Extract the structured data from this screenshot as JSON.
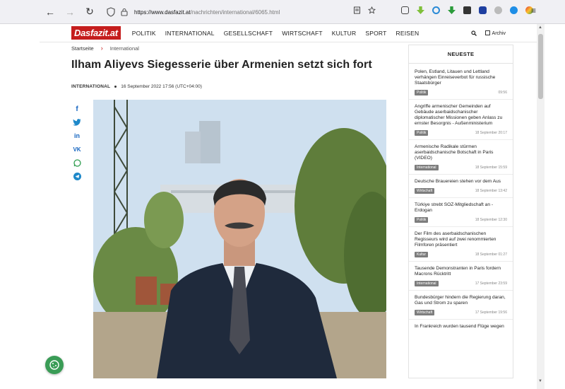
{
  "browser": {
    "url_host": "https://www.dasfazit.at",
    "url_path": "/nachrichten/international/6065.html",
    "icons": [
      "back-arrow-icon",
      "forward-arrow-icon",
      "reload-icon",
      "shield-icon",
      "lock-icon",
      "reader-view-icon",
      "bookmark-star-icon",
      "menu-icon"
    ]
  },
  "site": {
    "logo": "Dasfazit.at",
    "nav": [
      "POLITIK",
      "INTERNATIONAL",
      "GESELLSCHAFT",
      "WIRTSCHAFT",
      "KULTUR",
      "SPORT",
      "REISEN"
    ],
    "archive_label": "Archiv",
    "brand_color": "#c51d1d"
  },
  "breadcrumb": {
    "home": "Startseite",
    "separator": "›",
    "current": "International"
  },
  "article": {
    "title": "Ilham Aliyevs Siegesserie über Armenien setzt sich fort",
    "category": "INTERNATIONAL",
    "date": "16 September 2022 17:56 (UTC+04:00)"
  },
  "share_icons": [
    "facebook-icon",
    "twitter-icon",
    "linkedin-icon",
    "vk-icon",
    "whatsapp-icon",
    "telegram-icon"
  ],
  "sidebar": {
    "heading": "NEUESTE",
    "items": [
      {
        "title": "Polen, Estland, Litauen und Lettland verhängen Einreiseverbot für russische Staatsbürger",
        "category": "Politik",
        "time": "09:56"
      },
      {
        "title": "Angriffe armenischer Gemeinden auf Gebäude aserbaidschanischer diplomatischer Missionen geben Anlass zu ernster Besorgnis - Außenministerium",
        "category": "Politik",
        "time": "18 September 20:17"
      },
      {
        "title": "Armenische Radikale stürmen aserbaidschanische Botschaft in Paris (VIDEO)",
        "category": "International",
        "time": "18 September 15:59"
      },
      {
        "title": "Deutsche Brauereien stehen vor dem Aus",
        "category": "Wirtschaft",
        "time": "18 September 13:42"
      },
      {
        "title": "Türkiye strebt SOZ-Mitgliedschaft an - Erdogan",
        "category": "Politik",
        "time": "18 September 12:30"
      },
      {
        "title": "Der Film des aserbaidschanischen Regisseurs wird auf zwei renommierten Filmforen präsentiert",
        "category": "Kultur",
        "time": "18 September 01:27"
      },
      {
        "title": "Tausende Demonstranten in Paris fordern Macrons Rücktritt",
        "category": "International",
        "time": "17 September 23:59"
      },
      {
        "title": "Bundesbürger hindern die Regierung daran, Gas und Strom zu sparen",
        "category": "Wirtschaft",
        "time": "17 September 19:56"
      },
      {
        "title": "In Frankreich wurden tausend Flüge wegen",
        "category": "",
        "time": ""
      }
    ]
  }
}
